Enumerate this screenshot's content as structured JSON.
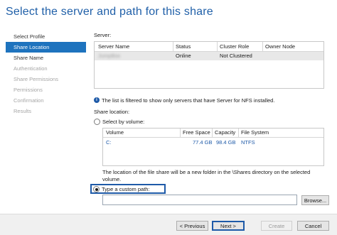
{
  "page_title": "Select the server and path for this share",
  "nav": {
    "items": [
      {
        "label": "Select Profile",
        "state": "normal"
      },
      {
        "label": "Share Location",
        "state": "active"
      },
      {
        "label": "Share Name",
        "state": "normal"
      },
      {
        "label": "Authentication",
        "state": "disabled"
      },
      {
        "label": "Share Permissions",
        "state": "disabled"
      },
      {
        "label": "Permissions",
        "state": "disabled"
      },
      {
        "label": "Confirmation",
        "state": "disabled"
      },
      {
        "label": "Results",
        "state": "disabled"
      }
    ]
  },
  "server": {
    "label": "Server:",
    "columns": [
      "Server Name",
      "Status",
      "Cluster Role",
      "Owner Node"
    ],
    "rows": [
      {
        "server_name": "JumpBox",
        "status": "Online",
        "cluster_role": "Not Clustered",
        "owner_node": ""
      }
    ]
  },
  "info_text": "The list is filtered to show only servers that have Server for NFS installed.",
  "share_location": {
    "label": "Share location:",
    "select_by_volume": "Select by volume:",
    "volume_columns": [
      "Volume",
      "Free Space",
      "Capacity",
      "File System"
    ],
    "volume_rows": [
      {
        "volume": "C:",
        "free_space": "77.4 GB",
        "capacity": "98.4 GB",
        "file_system": "NTFS"
      }
    ],
    "location_note_line1": "The location of the file share will be a new folder in the \\Shares directory on the selected",
    "location_note_line2": "volume.",
    "custom_path_label": "Type a custom path:",
    "custom_path_value": "",
    "selected_option": "custom_path"
  },
  "buttons": {
    "browse": "Browse...",
    "previous": "< Previous",
    "next": "Next >",
    "create": "Create",
    "cancel": "Cancel"
  },
  "colors": {
    "accent": "#1e73be",
    "title": "#1f5fa8",
    "highlight_border": "#1e5aa8"
  }
}
